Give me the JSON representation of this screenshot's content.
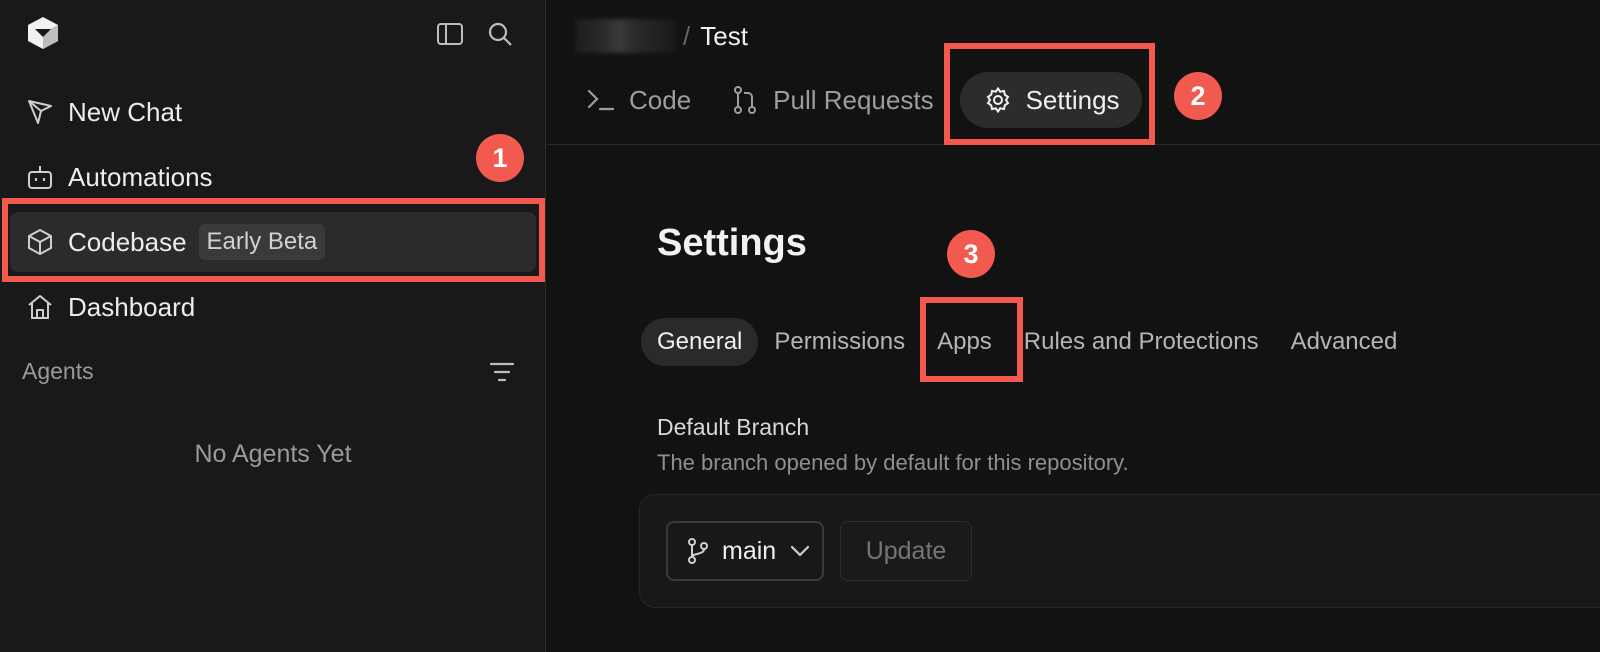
{
  "sidebar": {
    "items": [
      {
        "label": "New Chat",
        "icon": "send-icon"
      },
      {
        "label": "Automations",
        "icon": "robot-icon"
      },
      {
        "label": "Codebase",
        "badge": "Early Beta",
        "icon": "cube-icon",
        "active": true
      },
      {
        "label": "Dashboard",
        "icon": "home-icon"
      }
    ],
    "agents_label": "Agents",
    "empty_text": "No Agents Yet"
  },
  "breadcrumb": {
    "separator": "/",
    "title": "Test"
  },
  "tabs": [
    {
      "label": "Code",
      "icon": "terminal-icon"
    },
    {
      "label": "Pull Requests",
      "icon": "pull-request-icon"
    },
    {
      "label": "Settings",
      "icon": "gear-icon",
      "selected": true
    }
  ],
  "settings": {
    "title": "Settings",
    "subtabs": [
      {
        "label": "General",
        "selected": true
      },
      {
        "label": "Permissions"
      },
      {
        "label": "Apps"
      },
      {
        "label": "Rules and Protections"
      },
      {
        "label": "Advanced"
      }
    ],
    "default_branch": {
      "label": "Default Branch",
      "description": "The branch opened by default for this repository.",
      "value": "main",
      "update_label": "Update"
    }
  },
  "annotations": [
    "1",
    "2",
    "3"
  ],
  "colors": {
    "highlight": "#f25a50",
    "background": "#121212",
    "sidebar": "#191919"
  }
}
